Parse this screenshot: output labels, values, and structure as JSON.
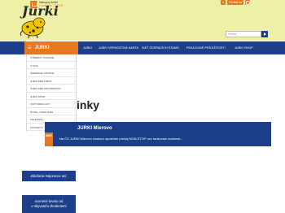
{
  "colors": {
    "header_bg": "#eef0a8",
    "accent": "#e87722",
    "navy": "#1c3f8a"
  },
  "cart": {
    "title": "Nákupný košík",
    "price": "0 položiek - 0 EUR",
    "icon": "cart-icon"
  },
  "topbar": {
    "login_label": "Prihlásiť sa"
  },
  "logo": {
    "text": "Jurki"
  },
  "search": {
    "placeholder": "hľadať",
    "icon": "arrow-right-icon"
  },
  "nav": {
    "menu_label": "JURKI",
    "items": [
      "JURKI",
      "JURKI VERNOSTNÁ KARTA",
      "SIEŤ ČERPACÍCH STANÍC",
      "PRACOVNÉ PRÍLEŽITOSTI",
      "JURKI SHOP"
    ]
  },
  "dropdown": {
    "items": [
      {
        "label": "VÝBERNÝ KONANIE",
        "arrow": ""
      },
      {
        "label": "O NÁS",
        "arrow": "›"
      },
      {
        "label": "ČERPACIE STANICE",
        "arrow": "›"
      },
      {
        "label": "JURKI PRE FIRMY",
        "arrow": "›"
      },
      {
        "label": "JURKI PRE MOTORISTOV",
        "arrow": "›"
      },
      {
        "label": "JURKI SHOP",
        "arrow": ""
      },
      {
        "label": "UMÝVÁRKA AUT",
        "arrow": "›"
      },
      {
        "label": "HOTEL JURKI DOM",
        "arrow": ""
      },
      {
        "label": "TELEFÓNY",
        "arrow": "›"
      },
      {
        "label": "KONTAKTY",
        "arrow": ""
      }
    ]
  },
  "main": {
    "heading": "inky",
    "news_title": "JURKI Mierovo",
    "news_date": "MAR",
    "news_text": "Na ČS JURKI Mierovo čoskoro spustíme predaj NON-STOP cez tankovací automat..."
  },
  "buttons": {
    "first": "Zdieľanie Nájomcov ani:",
    "second_line1": "ocenené tovaru od",
    "second_line2": "v obyvateľa zhodnotení"
  }
}
